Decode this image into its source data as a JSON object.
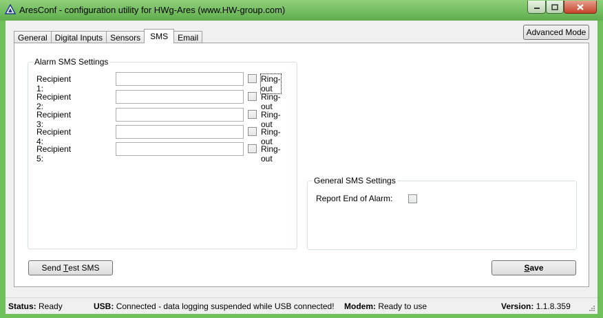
{
  "window": {
    "title": "AresConf - configuration utility for HWg-Ares (www.HW-group.com)",
    "icon": "triangle-logo-icon"
  },
  "tabs": [
    {
      "label": "General",
      "active": false
    },
    {
      "label": "Digital Inputs",
      "active": false
    },
    {
      "label": "Sensors",
      "active": false
    },
    {
      "label": "SMS",
      "active": true
    },
    {
      "label": "Email",
      "active": false
    }
  ],
  "advanced_button": {
    "label": "Advanced Mode"
  },
  "alarm_group": {
    "title": "Alarm SMS Settings",
    "recipients": [
      {
        "label": "Recipient 1:",
        "value": "",
        "ringout_label": "Ring-out",
        "ringout_checked": false
      },
      {
        "label": "Recipient 2:",
        "value": "",
        "ringout_label": "Ring-out",
        "ringout_checked": false
      },
      {
        "label": "Recipient 3:",
        "value": "",
        "ringout_label": "Ring-out",
        "ringout_checked": false
      },
      {
        "label": "Recipient 4:",
        "value": "",
        "ringout_label": "Ring-out",
        "ringout_checked": false
      },
      {
        "label": "Recipient 5:",
        "value": "",
        "ringout_label": "Ring-out",
        "ringout_checked": false
      }
    ]
  },
  "general_group": {
    "title": "General SMS Settings",
    "report_label": "Report End of Alarm:",
    "report_checked": false
  },
  "buttons": {
    "send_test_pre": "Send ",
    "send_test_underline": "T",
    "send_test_post": "est SMS",
    "save_underline": "S",
    "save_post": "ave"
  },
  "status": {
    "status_label": "Status:",
    "status_value": "Ready",
    "usb_label": "USB:",
    "usb_value": "Connected - data logging suspended while USB connected!",
    "modem_label": "Modem:",
    "modem_value": "Ready to use",
    "version_label": "Version:",
    "version_value": "1.1.8.359"
  }
}
